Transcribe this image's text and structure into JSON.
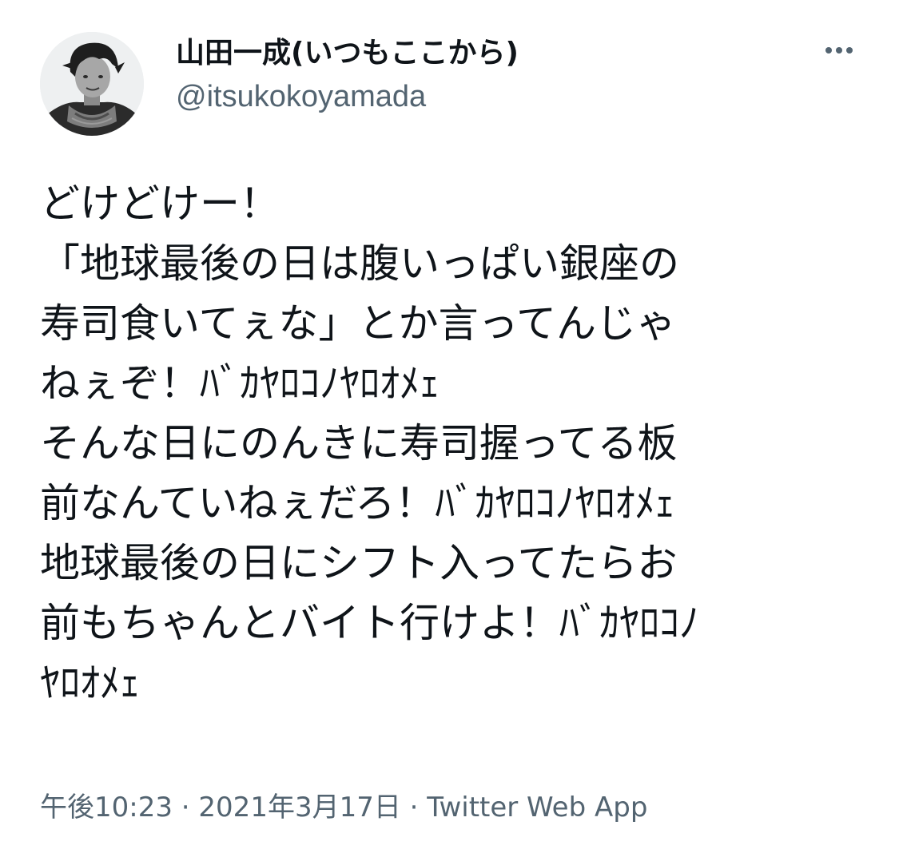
{
  "tweet": {
    "author": {
      "display_name": "山田一成(いつもここから)",
      "handle": "@itsukokoyamada"
    },
    "more_icon": "more-horizontal-icon",
    "body_lines": [
      "どけどけー！",
      "「地球最後の日は腹いっぱい銀座の",
      "寿司食いてぇな」とか言ってんじゃ",
      "ねぇぞ！ﾊﾞｶﾔﾛｺﾉﾔﾛｵﾒｪ",
      "そんな日にのんきに寿司握ってる板",
      "前なんていねぇだろ！ﾊﾞｶﾔﾛｺﾉﾔﾛｵﾒｪ",
      "地球最後の日にシフト入ってたらお",
      "前もちゃんとバイト行けよ！ﾊﾞｶﾔﾛｺﾉ",
      "ﾔﾛｵﾒｪ"
    ],
    "meta": {
      "time": "午後10:23",
      "separator": " · ",
      "date": "2021年3月17日",
      "source": "Twitter Web App"
    }
  },
  "colors": {
    "text_primary": "#0f1419",
    "text_secondary": "#536471",
    "background": "#ffffff"
  }
}
